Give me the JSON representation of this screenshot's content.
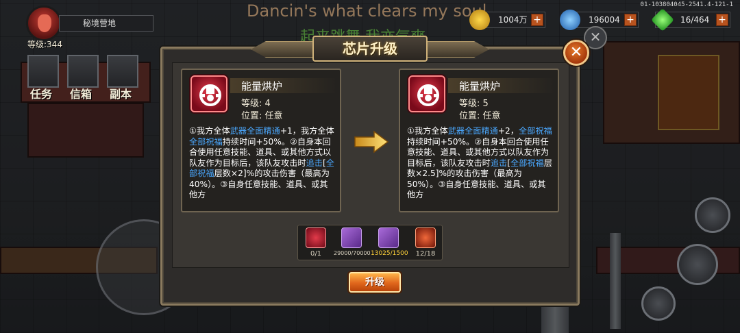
{
  "hud": {
    "location": "秘境营地",
    "player_level": "等级:344",
    "lyric_en": "Dancin's what clears my soul",
    "lyric_cn": "起来跳舞 我亦气爽",
    "resources": [
      {
        "value": "1004万",
        "icon": "gold-coin-icon",
        "color": "#e0a020"
      },
      {
        "value": "196004",
        "icon": "blue-gem-icon",
        "color": "#3a9be0"
      },
      {
        "value": "16/464",
        "icon": "green-crystal-icon",
        "color": "#3bc43b"
      }
    ],
    "build_id": "01-103804045-2541.4-121-1",
    "menu": [
      "任务",
      "信箱",
      "副本"
    ]
  },
  "dialog": {
    "title": "芯片升级",
    "close_label": "✕",
    "current": {
      "name": "能量烘炉",
      "level": "等级: 4",
      "position": "位置: 任意",
      "desc": [
        {
          "t": "①我方全体"
        },
        {
          "t": "武器全面精通",
          "hl": true
        },
        {
          "t": "+1，我方全体"
        },
        {
          "t": "全部祝福",
          "hl": true
        },
        {
          "t": "持续时间+50%。"
        },
        {
          "t": "②自身本回合使用任意技能、道具、或其他方式以队友作为目标后，该队友攻击时"
        },
        {
          "t": "追击",
          "hl": true
        },
        {
          "t": "["
        },
        {
          "t": "全部祝福",
          "hl": true
        },
        {
          "t": "层数×2]%的攻击伤害（最高为40%）。"
        },
        {
          "t": "③自身任意技能、道具、或其他方"
        }
      ]
    },
    "next": {
      "name": "能量烘炉",
      "level": "等级: 5",
      "position": "位置: 任意",
      "desc": [
        {
          "t": "①我方全体"
        },
        {
          "t": "武器全面精通",
          "hl": true
        },
        {
          "t": "+2，"
        },
        {
          "t": "全部祝福",
          "hl": true
        },
        {
          "t": "持续时间+50%。"
        },
        {
          "t": "②自身本回合使用任意技能、道具、或其他方式以队友作为目标后，该队友攻击时"
        },
        {
          "t": "追击",
          "hl": true
        },
        {
          "t": "["
        },
        {
          "t": "全部祝福",
          "hl": true
        },
        {
          "t": "层数×2.5]%的攻击伤害（最高为50%）。"
        },
        {
          "t": "③自身任意技能、道具、或其他方"
        }
      ]
    },
    "costs": [
      {
        "qty": "0/1",
        "icon": "chip-material-icon",
        "style": "chip",
        "qtyStyle": ""
      },
      {
        "qty": "29000/70000",
        "icon": "purple-book-icon",
        "style": "purple",
        "qtyStyle": "small"
      },
      {
        "qty": "13025/1500",
        "icon": "purple-anvil-icon",
        "style": "purple",
        "qtyStyle": "gold"
      },
      {
        "qty": "12/18",
        "icon": "red-core-icon",
        "style": "red",
        "qtyStyle": ""
      }
    ],
    "upgrade_label": "升级"
  }
}
